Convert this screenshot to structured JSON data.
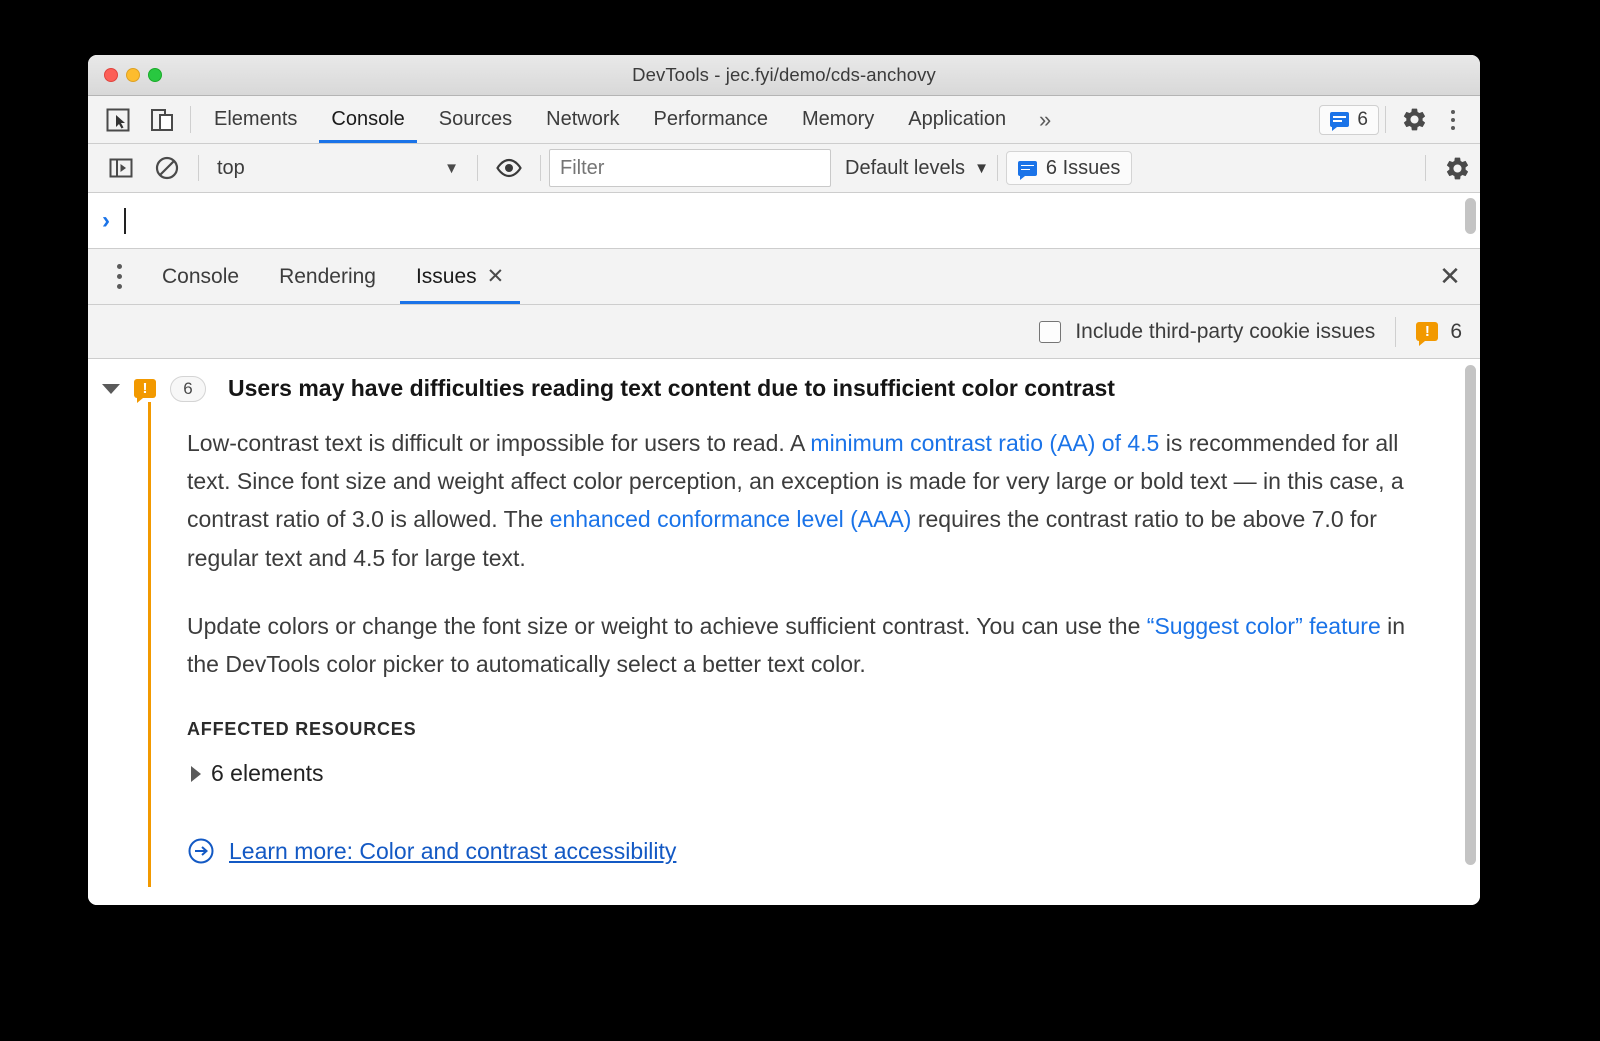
{
  "window": {
    "title": "DevTools - jec.fyi/demo/cds-anchovy",
    "traffic_lights": [
      "close",
      "minimize",
      "zoom"
    ]
  },
  "main_tabbar": {
    "inspect_icon": "inspect-cursor-icon",
    "device_icon": "device-toolbar-icon",
    "tabs": [
      {
        "label": "Elements",
        "active": false
      },
      {
        "label": "Console",
        "active": true
      },
      {
        "label": "Sources",
        "active": false
      },
      {
        "label": "Network",
        "active": false
      },
      {
        "label": "Performance",
        "active": false
      },
      {
        "label": "Memory",
        "active": false
      },
      {
        "label": "Application",
        "active": false
      }
    ],
    "more_tabs_label": "»",
    "issues_chip_count": "6",
    "settings_icon": "gear-icon",
    "menu_icon": "kebab-menu-icon"
  },
  "console_toolbar": {
    "sidebar_toggle_icon": "console-sidebar-icon",
    "clear_console_icon": "clear-console-icon",
    "context_value": "top",
    "context_caret": "▼",
    "eye_icon": "live-expression-eye-icon",
    "filter_placeholder": "Filter",
    "filter_value": "",
    "levels_label": "Default levels",
    "levels_caret": "▼",
    "issues_button_label": "6 Issues",
    "settings_icon": "gear-icon"
  },
  "console_prompt": {
    "caret": "›",
    "value": ""
  },
  "drawer": {
    "menu_icon": "kebab-menu-icon",
    "tabs": [
      {
        "label": "Console",
        "active": false,
        "closable": false
      },
      {
        "label": "Rendering",
        "active": false,
        "closable": false
      },
      {
        "label": "Issues",
        "active": true,
        "closable": true,
        "close_glyph": "✕"
      }
    ],
    "close_drawer_glyph": "✕"
  },
  "issues_toolbar": {
    "third_party_label": "Include third-party cookie issues",
    "third_party_checked": false,
    "warning_count": "6",
    "warning_icon": "warning-bubble-icon"
  },
  "issue": {
    "expanded": true,
    "expand_glyph": "▼",
    "severity_icon": "warning-bubble-icon",
    "count": "6",
    "title": "Users may have difficulties reading text content due to insufficient color contrast",
    "paragraph1": {
      "part1": "Low-contrast text is difficult or impossible for users to read. A ",
      "link1": "minimum contrast ratio (AA) of 4.5",
      "part2": " is recommended for all text. Since font size and weight affect color perception, an exception is made for very large or bold text — in this case, a contrast ratio of 3.0 is allowed. The ",
      "link2": "enhanced conformance level (AAA)",
      "part3": " requires the contrast ratio to be above 7.0 for regular text and 4.5 for large text."
    },
    "paragraph2": {
      "part1": "Update colors or change the font size or weight to achieve sufficient contrast. You can use the ",
      "link1": "“Suggest color” feature",
      "part2": " in the DevTools color picker to automatically select a better text color."
    },
    "affected_resources_heading": "AFFECTED RESOURCES",
    "affected_resources_item": "6 elements",
    "affected_resources_expand_glyph": "▶",
    "learn_more_icon": "external-link-circle-arrow-icon",
    "learn_more_label": "Learn more: Color and contrast accessibility"
  },
  "colors": {
    "accent_blue": "#1a73e8",
    "link_blue": "#1359c4",
    "warning_orange": "#f29900",
    "toolbar_bg": "#f3f3f3",
    "panel_bg": "#ffffff",
    "text": "#3c3c3c",
    "desktop_bg": "#000000"
  }
}
